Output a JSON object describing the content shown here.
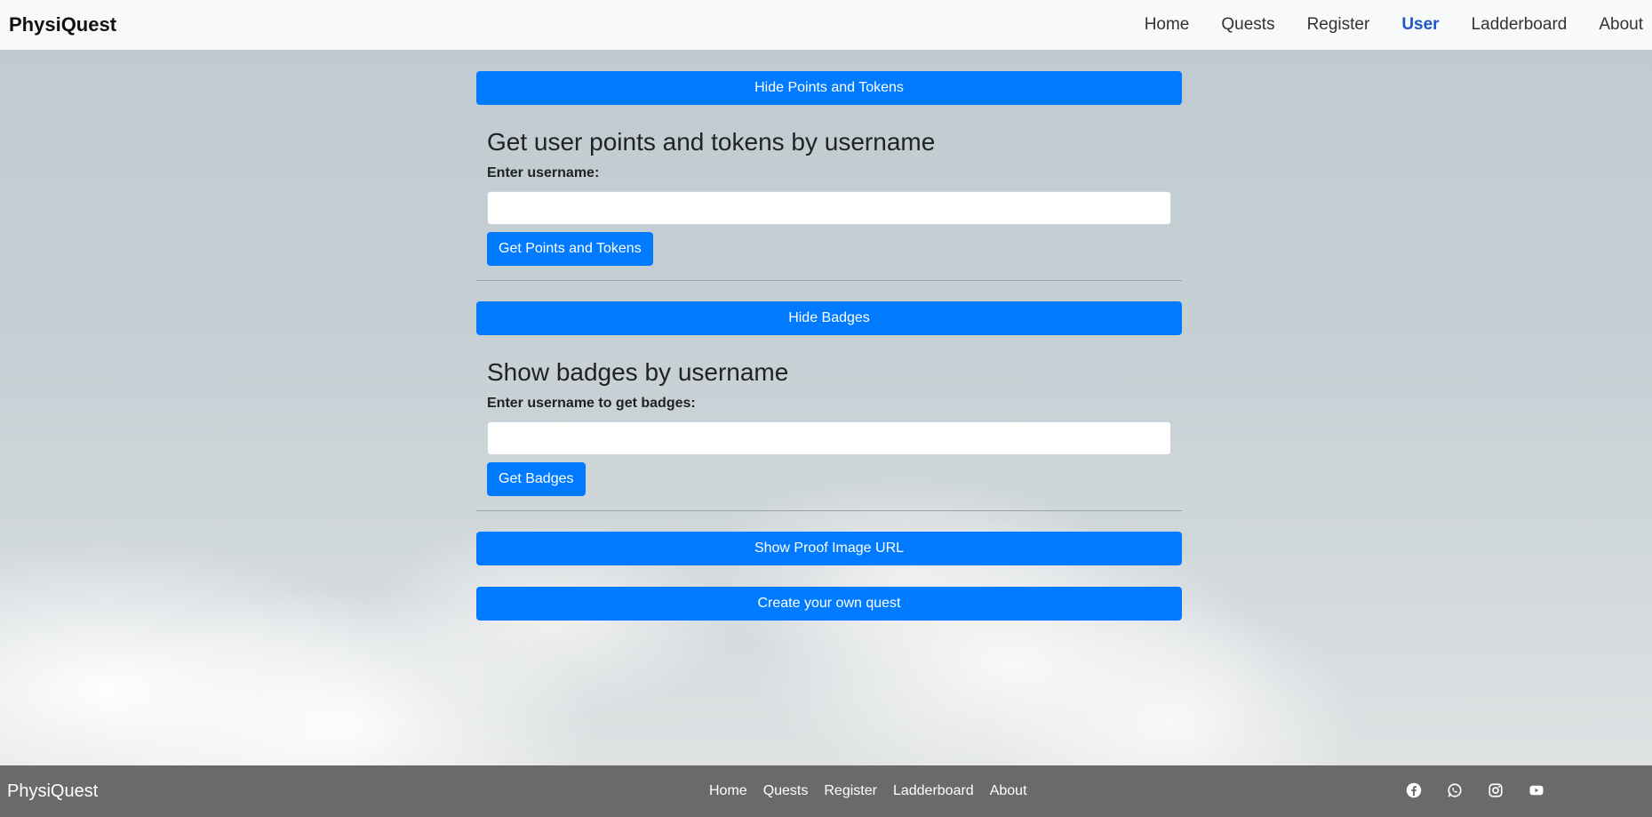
{
  "nav": {
    "brand": "PhysiQuest",
    "links": [
      {
        "label": "Home"
      },
      {
        "label": "Quests"
      },
      {
        "label": "Register"
      },
      {
        "label": "User",
        "active": true
      },
      {
        "label": "Ladderboard"
      },
      {
        "label": "About"
      }
    ]
  },
  "main": {
    "toggle_points_label": "Hide Points and Tokens",
    "points_section": {
      "title": "Get user points and tokens by username",
      "label": "Enter username:",
      "input_value": "",
      "button_label": "Get Points and Tokens"
    },
    "toggle_badges_label": "Hide Badges",
    "badges_section": {
      "title": "Show badges by username",
      "label": "Enter username to get badges:",
      "input_value": "",
      "button_label": "Get Badges"
    },
    "proof_image_label": "Show Proof Image URL",
    "create_quest_label": "Create your own quest"
  },
  "footer": {
    "brand": "PhysiQuest",
    "links": [
      "Home",
      "Quests",
      "Register",
      "Ladderboard",
      "About"
    ],
    "social_icons": [
      "facebook-icon",
      "whatsapp-icon",
      "instagram-icon",
      "youtube-icon"
    ]
  },
  "colors": {
    "primary": "#007bff",
    "nav_active": "#1e56c4",
    "footer_bg": "#6b6a6a",
    "navbar_bg": "#f8f9fa"
  }
}
